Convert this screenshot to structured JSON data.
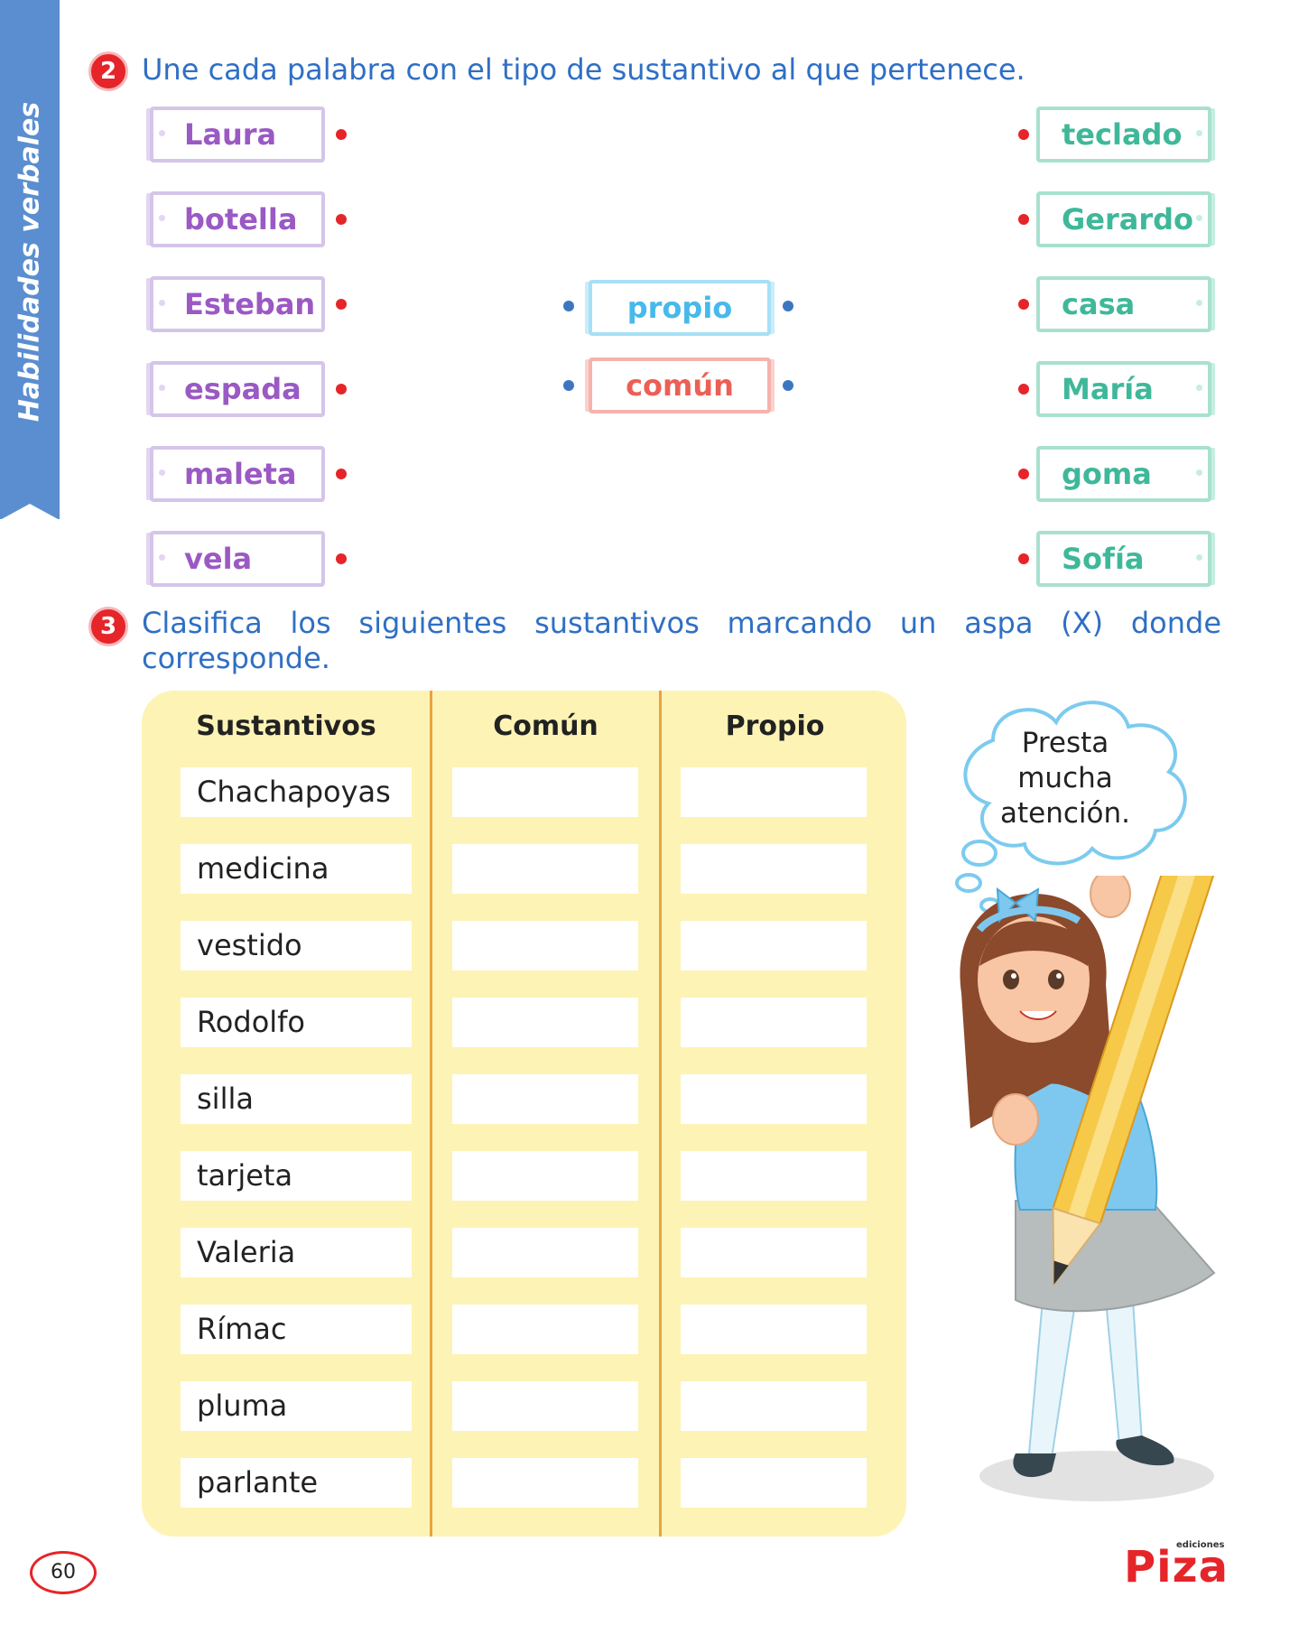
{
  "side_tab": {
    "label": "Habilidades verbales"
  },
  "exercise2": {
    "number": "2",
    "instruction": "Une cada palabra con el tipo de sustantivo al que pertenece.",
    "left_words": [
      "Laura",
      "botella",
      "Esteban",
      "espada",
      "maleta",
      "vela"
    ],
    "center_types": [
      "propio",
      "común"
    ],
    "right_words": [
      "teclado",
      "Gerardo",
      "casa",
      "María",
      "goma",
      "Sofía"
    ]
  },
  "exercise3": {
    "number": "3",
    "instruction_line1": "Clasifica los siguientes sustantivos marcando un aspa (X) donde",
    "instruction_line2": "corresponde.",
    "headers": [
      "Sustantivos",
      "Común",
      "Propio"
    ],
    "rows": [
      "Chachapoyas",
      "medicina",
      "vestido",
      "Rodolfo",
      "silla",
      "tarjeta",
      "Valeria",
      "Rímac",
      "pluma",
      "parlante"
    ]
  },
  "thought": {
    "line1": "Presta",
    "line2": "mucha",
    "line3": "atención."
  },
  "footer": {
    "page_number": "60",
    "brand": "Piza",
    "brand_prefix": "ediciones"
  },
  "colors": {
    "accent_red": "#e5252a",
    "text_blue": "#2f6fc4",
    "table_bg": "#fdf3b5",
    "divider": "#e8a340"
  }
}
